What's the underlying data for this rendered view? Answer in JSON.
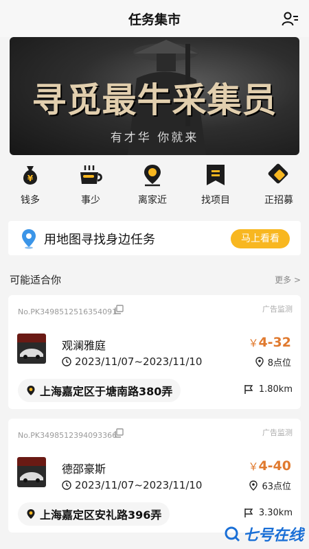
{
  "header": {
    "title": "任务集市",
    "user_icon": "user-list-icon"
  },
  "banner": {
    "headline": "寻觅最牛采集员",
    "subline": "有才华 你就来"
  },
  "quick_links": [
    {
      "label": "钱多",
      "icon": "money-bag-icon"
    },
    {
      "label": "事少",
      "icon": "coffee-cup-icon"
    },
    {
      "label": "离家近",
      "icon": "location-pin-icon"
    },
    {
      "label": "找项目",
      "icon": "project-folder-icon"
    },
    {
      "label": "正招募",
      "icon": "recruit-badge-icon"
    }
  ],
  "map_search": {
    "text": "用地图寻找身边任务",
    "button": "马上看看"
  },
  "section": {
    "title": "可能适合你",
    "more": "更多 >"
  },
  "tasks": [
    {
      "no": "No.PK3498512516354091",
      "ad": "广告监测",
      "name": "观澜雅庭",
      "date": "2023/11/07~2023/11/10",
      "price_symbol": "￥",
      "price": "4-32",
      "spots": "8点位",
      "address": "上海嘉定区于塘南路380弄",
      "distance": "1.80km"
    },
    {
      "no": "No.PK3498512394093366",
      "ad": "广告监测",
      "name": "德邵豪斯",
      "date": "2023/11/07~2023/11/10",
      "price_symbol": "￥",
      "price": "4-40",
      "spots": "63点位",
      "address": "上海嘉定区安礼路396弄",
      "distance": "3.30km"
    }
  ],
  "watermark": "七号在线",
  "colors": {
    "accent": "#f8b720",
    "price": "#e07a2f",
    "brand_dark": "#1c1c1c",
    "watermark": "#1a6fd6"
  }
}
